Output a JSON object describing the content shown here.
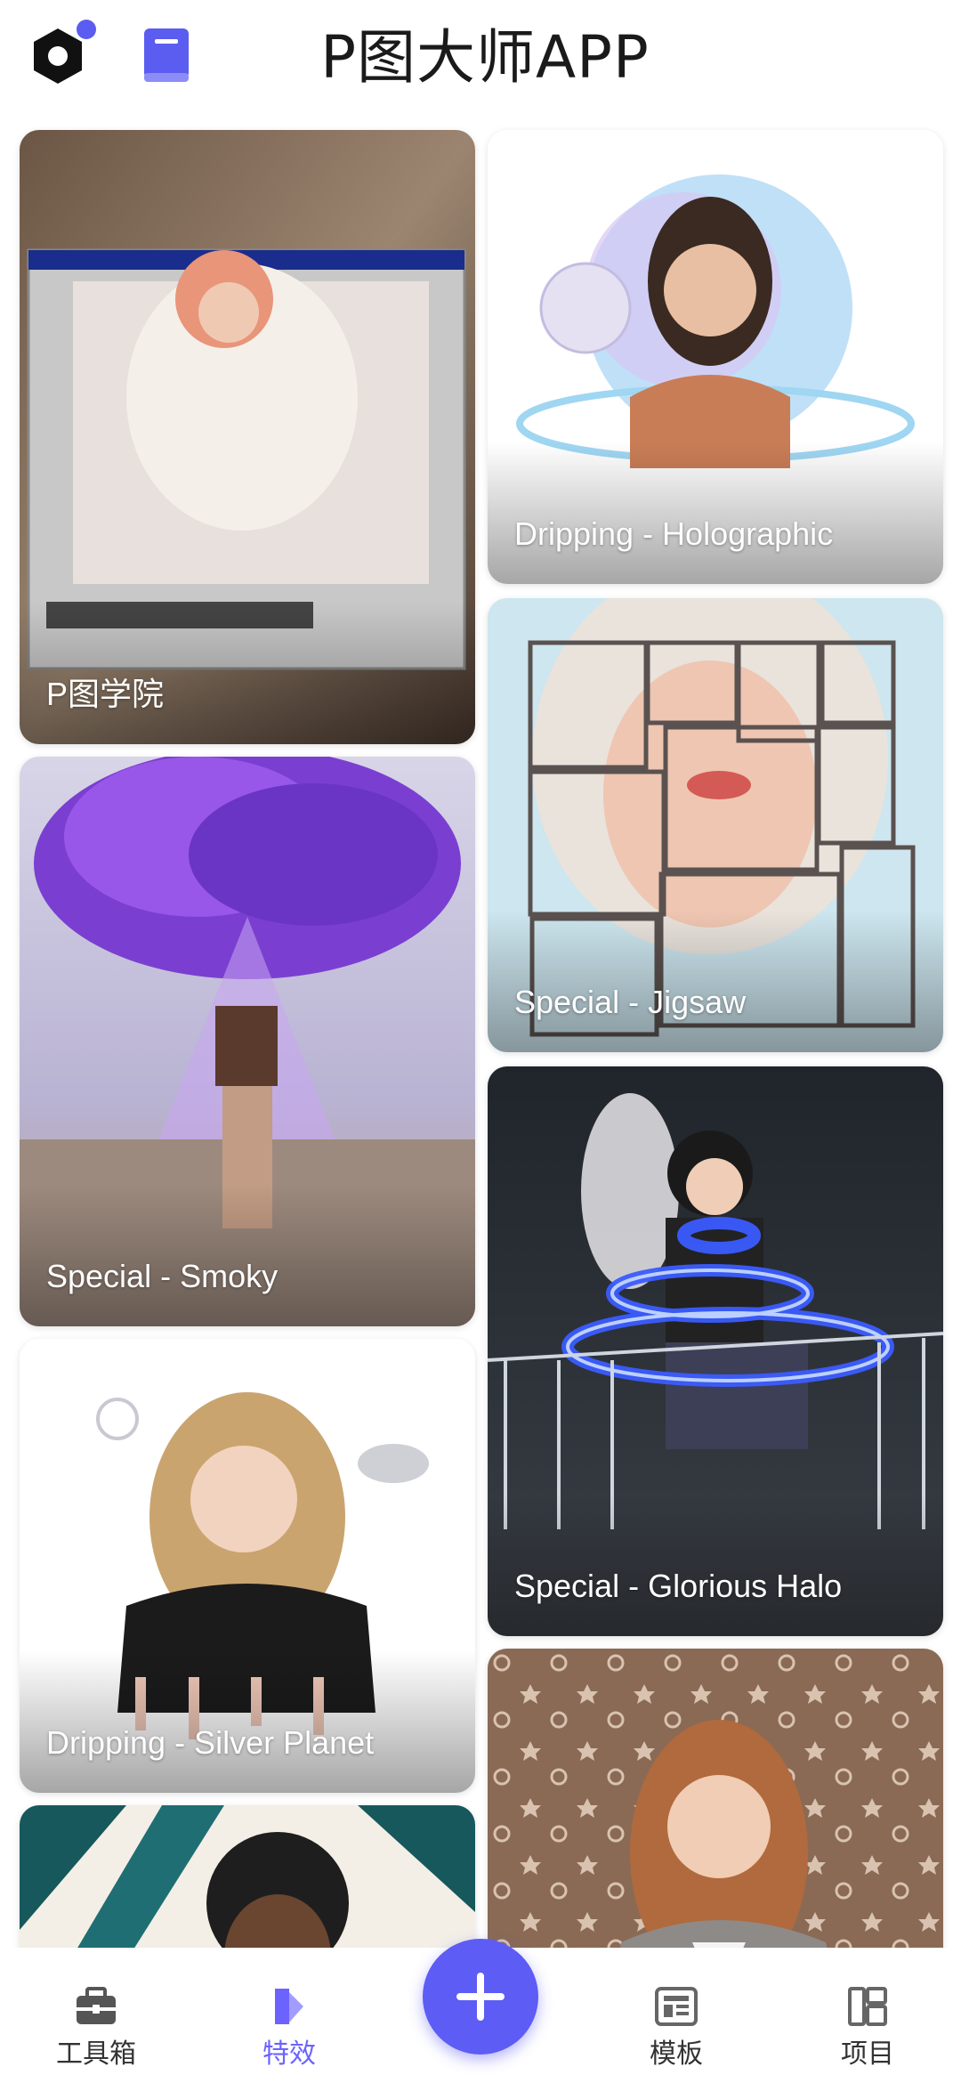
{
  "header": {
    "title": "P图大师APP",
    "settings_icon": "gear-icon",
    "book_icon": "book-icon",
    "accent": "#5b5cf0"
  },
  "cards": [
    {
      "label": "P图学院",
      "icon": "paint-window-photo"
    },
    {
      "label": "Dripping - Holographic",
      "icon": "holographic-portrait"
    },
    {
      "label": "Special - Jigsaw",
      "icon": "jigsaw-portrait"
    },
    {
      "label": "Special - Smoky",
      "icon": "smoky-head-photo"
    },
    {
      "label": "Special - Glorious Halo",
      "icon": "neon-halo-photo"
    },
    {
      "label": "Dripping - Silver Planet",
      "icon": "silver-planet-portrait"
    },
    {
      "label": "",
      "icon": "curly-hair-portrait"
    },
    {
      "label": "",
      "icon": "pattern-background-portrait"
    }
  ],
  "nav": {
    "items": [
      {
        "label": "工具箱",
        "icon": "toolbox-icon"
      },
      {
        "label": "特效",
        "icon": "effects-icon",
        "active": true
      },
      {
        "label": "模板",
        "icon": "template-icon"
      },
      {
        "label": "项目",
        "icon": "project-icon"
      }
    ],
    "fab_icon": "plus-icon",
    "active_color": "#6c63ff",
    "fab_color": "#5d5cf5"
  }
}
